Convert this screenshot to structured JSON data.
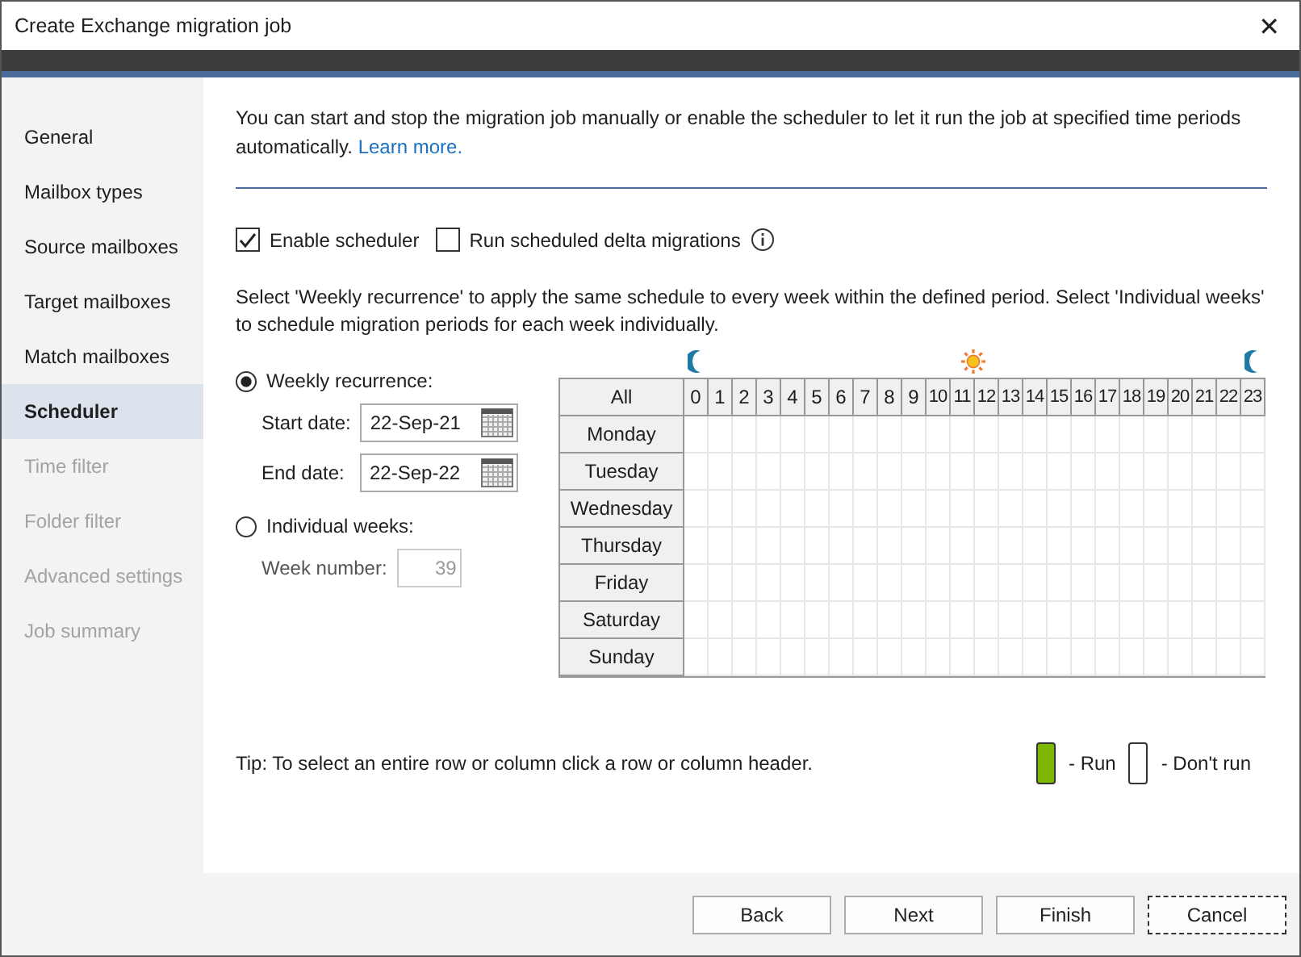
{
  "window": {
    "title": "Create Exchange migration job",
    "close": "✕"
  },
  "sidebar": {
    "items": [
      {
        "label": "General",
        "selected": false,
        "disabled": false
      },
      {
        "label": "Mailbox types",
        "selected": false,
        "disabled": false
      },
      {
        "label": "Source mailboxes",
        "selected": false,
        "disabled": false
      },
      {
        "label": "Target mailboxes",
        "selected": false,
        "disabled": false
      },
      {
        "label": "Match mailboxes",
        "selected": false,
        "disabled": false
      },
      {
        "label": "Scheduler",
        "selected": true,
        "disabled": false
      },
      {
        "label": "Time filter",
        "selected": false,
        "disabled": true
      },
      {
        "label": "Folder filter",
        "selected": false,
        "disabled": true
      },
      {
        "label": "Advanced settings",
        "selected": false,
        "disabled": true
      },
      {
        "label": "Job summary",
        "selected": false,
        "disabled": true
      }
    ]
  },
  "intro": {
    "text": "You can start and stop the migration job manually or enable the scheduler to let it run the job at specified time periods automatically.",
    "link": "Learn more."
  },
  "options": [
    {
      "label": "Enable scheduler",
      "checked": true,
      "info": false
    },
    {
      "label": "Run scheduled delta migrations",
      "checked": false,
      "info": true
    }
  ],
  "description": "Select 'Weekly recurrence' to apply the same schedule to every week within the defined period. Select 'Individual weeks' to schedule migration periods for each week individually.",
  "modes": [
    {
      "label": "Weekly recurrence:",
      "selected": true,
      "fields": [
        {
          "label": "Start date:",
          "value": "22-Sep-21",
          "disabled": false,
          "calendar": true
        },
        {
          "label": "End date:",
          "value": "22-Sep-22",
          "disabled": false,
          "calendar": true
        }
      ]
    },
    {
      "label": "Individual weeks:",
      "selected": false,
      "fields": [
        {
          "label": "Week number:",
          "value": "39",
          "disabled": true,
          "calendar": false
        }
      ]
    }
  ],
  "grid": {
    "all": "All",
    "hours": [
      "0",
      "1",
      "2",
      "3",
      "4",
      "5",
      "6",
      "7",
      "8",
      "9",
      "10",
      "11",
      "12",
      "13",
      "14",
      "15",
      "16",
      "17",
      "18",
      "19",
      "20",
      "21",
      "22",
      "23"
    ],
    "rows": [
      {
        "day": "Monday",
        "run": [
          false,
          false,
          false,
          false,
          false,
          false,
          false,
          false,
          false,
          false,
          false,
          false,
          false,
          false,
          false,
          false,
          false,
          false,
          false,
          false,
          false,
          false,
          false,
          false
        ]
      },
      {
        "day": "Tuesday",
        "run": [
          false,
          false,
          false,
          false,
          false,
          false,
          false,
          false,
          false,
          false,
          false,
          false,
          false,
          false,
          false,
          false,
          false,
          false,
          false,
          false,
          false,
          false,
          false,
          false
        ]
      },
      {
        "day": "Wednesday",
        "run": [
          false,
          false,
          false,
          false,
          false,
          false,
          false,
          false,
          false,
          false,
          false,
          false,
          false,
          false,
          false,
          false,
          false,
          false,
          false,
          false,
          false,
          false,
          false,
          false
        ]
      },
      {
        "day": "Thursday",
        "run": [
          false,
          false,
          false,
          false,
          false,
          false,
          false,
          false,
          false,
          false,
          false,
          false,
          false,
          false,
          false,
          false,
          false,
          false,
          false,
          false,
          false,
          false,
          false,
          false
        ]
      },
      {
        "day": "Friday",
        "run": [
          false,
          false,
          false,
          false,
          false,
          false,
          false,
          false,
          false,
          false,
          false,
          false,
          false,
          false,
          false,
          false,
          false,
          false,
          false,
          false,
          false,
          false,
          false,
          false
        ]
      },
      {
        "day": "Saturday",
        "run": [
          false,
          false,
          false,
          false,
          false,
          false,
          false,
          false,
          false,
          false,
          false,
          false,
          false,
          false,
          false,
          false,
          false,
          false,
          false,
          false,
          false,
          false,
          false,
          false
        ]
      },
      {
        "day": "Sunday",
        "run": [
          false,
          false,
          false,
          false,
          false,
          false,
          false,
          false,
          false,
          false,
          false,
          false,
          false,
          false,
          false,
          false,
          false,
          false,
          false,
          false,
          false,
          false,
          false,
          false
        ]
      }
    ]
  },
  "tip": "Tip: To select an entire row or column click a row or column header.",
  "legend": [
    {
      "label": "- Run",
      "color": "#7fb800"
    },
    {
      "label": "- Don't run",
      "color": "#ffffff"
    }
  ],
  "buttons": [
    {
      "label": "Back",
      "focused": false
    },
    {
      "label": "Next",
      "focused": false
    },
    {
      "label": "Finish",
      "focused": false
    },
    {
      "label": "Cancel",
      "focused": true
    }
  ]
}
